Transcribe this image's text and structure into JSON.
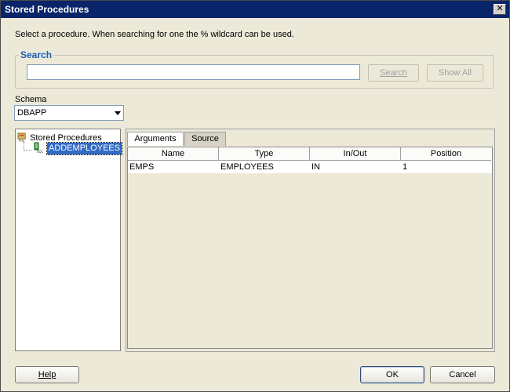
{
  "window": {
    "title": "Stored Procedures"
  },
  "instruction": "Select a procedure. When searching for one the % wildcard can be used.",
  "search": {
    "group_label": "Search",
    "value": "",
    "search_button": "Search",
    "show_all_button": "Show All"
  },
  "schema": {
    "label": "Schema",
    "selected": "DBAPP"
  },
  "tree": {
    "root_label": "Stored Procedures",
    "items": [
      {
        "label": "ADDEMPLOYEES"
      }
    ]
  },
  "tabs": [
    {
      "label": "Arguments"
    },
    {
      "label": "Source"
    }
  ],
  "arguments_table": {
    "columns": [
      "Name",
      "Type",
      "In/Out",
      "Position"
    ],
    "rows": [
      [
        "EMPS",
        "EMPLOYEES",
        "IN",
        "1"
      ]
    ]
  },
  "footer": {
    "help": "Help",
    "ok": "OK",
    "cancel": "Cancel"
  },
  "colors": {
    "titlebar": "#0a246a",
    "selection": "#316ac5",
    "legend": "#1f5fb8",
    "dialog_bg": "#ece9d8"
  }
}
